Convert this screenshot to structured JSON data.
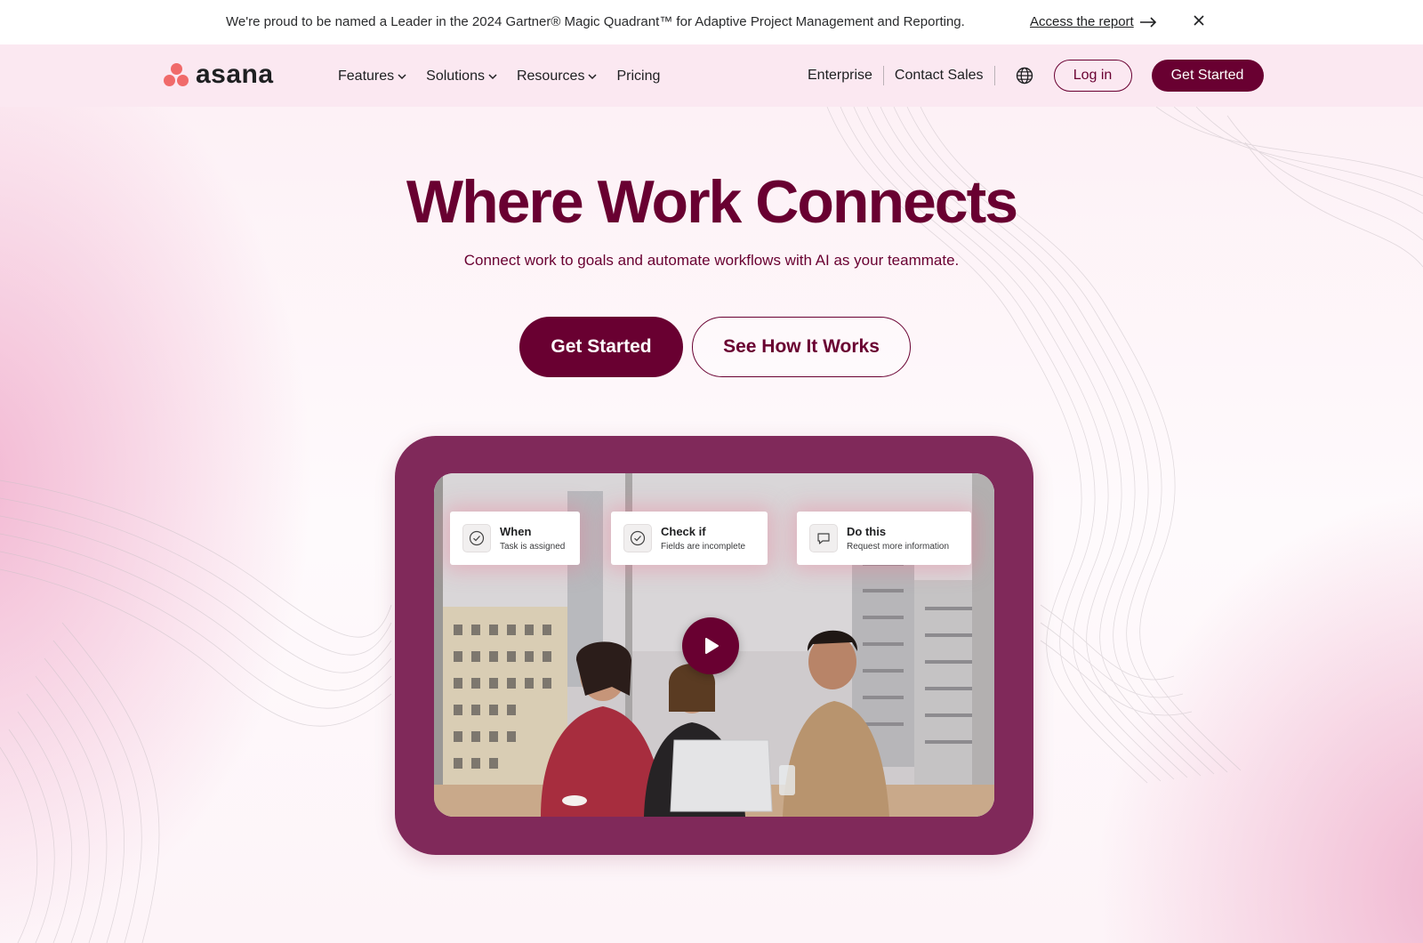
{
  "banner": {
    "text": "We're proud to be named a Leader in the 2024 Gartner® Magic Quadrant™ for Adaptive Project Management and Reporting.",
    "link_label": "Access the report",
    "close_icon": "close-icon"
  },
  "nav": {
    "logo_text": "asana",
    "menu": [
      {
        "label": "Features",
        "has_dropdown": true
      },
      {
        "label": "Solutions",
        "has_dropdown": true
      },
      {
        "label": "Resources",
        "has_dropdown": true
      },
      {
        "label": "Pricing",
        "has_dropdown": false
      }
    ],
    "enterprise_label": "Enterprise",
    "contact_label": "Contact Sales",
    "globe_icon": "globe-icon",
    "login_label": "Log in",
    "get_started_label": "Get Started"
  },
  "hero": {
    "title": "Where Work Connects",
    "subtitle": "Connect work to goals and automate workflows with AI as your teammate.",
    "primary_cta": "Get Started",
    "secondary_cta": "See How It Works"
  },
  "video": {
    "cards": [
      {
        "title": "When",
        "subtitle": "Task is assigned",
        "icon": "check-circle-icon"
      },
      {
        "title": "Check if",
        "subtitle": "Fields are incomplete",
        "icon": "check-circle-icon"
      },
      {
        "title": "Do this",
        "subtitle": "Request more information",
        "icon": "comment-icon"
      }
    ],
    "play_icon": "play-icon"
  },
  "colors": {
    "brand": "#690031",
    "frame": "#80295a",
    "logo_coral": "#f06a6a",
    "nav_bg": "#fbe8f1"
  }
}
